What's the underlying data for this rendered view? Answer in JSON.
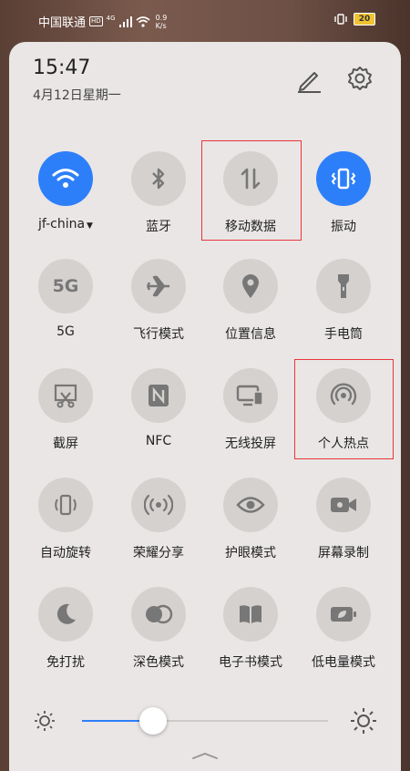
{
  "status_bar": {
    "carrier": "中国联通",
    "hd": "HD",
    "network": "4G",
    "speed_value": "0.9",
    "speed_unit": "K/s",
    "battery": "20"
  },
  "header": {
    "time": "15:47",
    "date": "4月12日星期一"
  },
  "tiles": [
    {
      "label": "jf-china",
      "icon": "wifi-icon",
      "active": true,
      "dropdown": true
    },
    {
      "label": "蓝牙",
      "icon": "bluetooth-icon",
      "active": false
    },
    {
      "label": "移动数据",
      "icon": "mobile-data-icon",
      "active": false
    },
    {
      "label": "振动",
      "icon": "vibrate-icon",
      "active": true
    },
    {
      "label": "5G",
      "icon": "5g-icon",
      "icon_text": "5G",
      "active": false
    },
    {
      "label": "飞行模式",
      "icon": "airplane-icon",
      "active": false
    },
    {
      "label": "位置信息",
      "icon": "location-icon",
      "active": false
    },
    {
      "label": "手电筒",
      "icon": "flashlight-icon",
      "active": false
    },
    {
      "label": "截屏",
      "icon": "screenshot-icon",
      "active": false
    },
    {
      "label": "NFC",
      "icon": "nfc-icon",
      "active": false
    },
    {
      "label": "无线投屏",
      "icon": "cast-icon",
      "active": false
    },
    {
      "label": "个人热点",
      "icon": "hotspot-icon",
      "active": false
    },
    {
      "label": "自动旋转",
      "icon": "rotate-icon",
      "active": false
    },
    {
      "label": "荣耀分享",
      "icon": "share-icon",
      "active": false
    },
    {
      "label": "护眼模式",
      "icon": "eye-icon",
      "active": false
    },
    {
      "label": "屏幕录制",
      "icon": "screen-record-icon",
      "active": false
    },
    {
      "label": "免打扰",
      "icon": "moon-icon",
      "active": false
    },
    {
      "label": "深色模式",
      "icon": "dark-mode-icon",
      "active": false
    },
    {
      "label": "电子书模式",
      "icon": "ebook-icon",
      "active": false
    },
    {
      "label": "低电量模式",
      "icon": "battery-saver-icon",
      "active": false
    }
  ],
  "brightness": {
    "level": 0.29
  },
  "colors": {
    "accent": "#2d7ff9",
    "highlight": "#e8353a",
    "panel": "#e9e6e5",
    "tile_off": "#d5d1cf"
  }
}
